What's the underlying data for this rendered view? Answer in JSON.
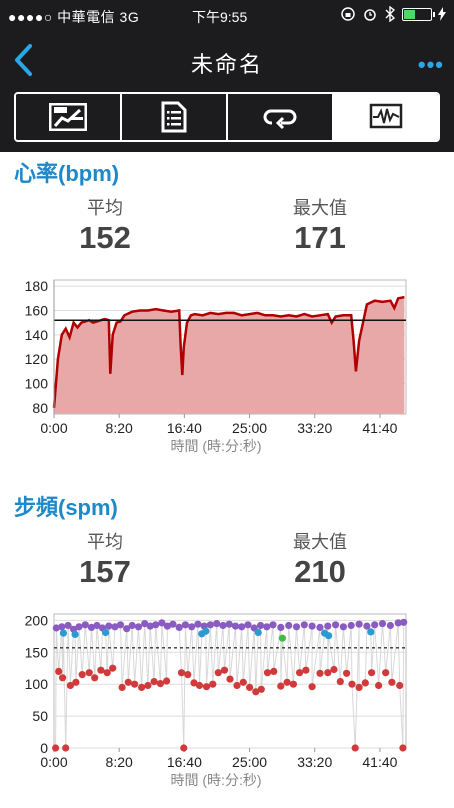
{
  "status_bar": {
    "carrier": "●●●●○ 中華電信 3G",
    "time": "下午9:55"
  },
  "nav": {
    "title": "未命名",
    "more_label": "•••"
  },
  "tabs": [
    {
      "icon": "summary-chart-icon",
      "active": false
    },
    {
      "icon": "document-list-icon",
      "active": false
    },
    {
      "icon": "laps-loop-icon",
      "active": false
    },
    {
      "icon": "graph-monitor-icon",
      "active": true
    }
  ],
  "heart_rate": {
    "title": "心率(bpm)",
    "avg_label": "平均",
    "avg_value": "152",
    "max_label": "最大值",
    "max_value": "171"
  },
  "cadence": {
    "title": "步頻(spm)",
    "avg_label": "平均",
    "avg_value": "157",
    "max_label": "最大值",
    "max_value": "210"
  },
  "colors": {
    "accent": "#1e88c8",
    "hr_line": "#b00000",
    "hr_fill": "#e8a8a8",
    "cad_purple": "#8a5cc2",
    "cad_blue": "#2a9ad0",
    "cad_green": "#45b84a",
    "cad_red": "#d03a3a"
  },
  "chart_data": [
    {
      "type": "area",
      "x_unit": "minutes",
      "xlabel": "時間 (時:分:秒)",
      "ylabel": "",
      "xlim": [
        0,
        45
      ],
      "ylim": [
        75,
        185
      ],
      "x_ticks": [
        "0:00",
        "8:20",
        "16:40",
        "25:00",
        "33:20",
        "41:40"
      ],
      "x_tick_values": [
        0,
        8.333,
        16.667,
        25,
        33.333,
        41.667
      ],
      "y_ticks": [
        80,
        100,
        120,
        140,
        160,
        180
      ],
      "average_line": 152,
      "x": [
        0,
        0.5,
        1,
        1.5,
        2,
        2.5,
        3,
        3.5,
        4,
        4.5,
        5,
        5.5,
        6,
        6.5,
        7,
        7.2,
        7.5,
        8,
        8.5,
        9,
        10,
        11,
        12,
        13,
        14,
        15,
        16,
        16.2,
        16.4,
        16.6,
        17,
        17.5,
        18,
        19,
        20,
        21,
        22,
        23,
        24,
        25,
        26,
        27,
        28,
        29,
        30,
        31,
        32,
        33,
        34,
        35,
        35.5,
        36,
        37,
        38,
        38.3,
        38.6,
        39,
        40,
        41,
        42,
        43,
        43.5,
        44,
        44.8
      ],
      "values": [
        80,
        120,
        140,
        145,
        138,
        150,
        146,
        150,
        151,
        152,
        150,
        151,
        152,
        153,
        152,
        108,
        140,
        150,
        151,
        156,
        159,
        160,
        160,
        161,
        160,
        159,
        160,
        130,
        107,
        130,
        150,
        156,
        157,
        156,
        158,
        157,
        158,
        158,
        156,
        157,
        158,
        156,
        156,
        155,
        156,
        155,
        157,
        155,
        156,
        157,
        150,
        155,
        156,
        156,
        135,
        110,
        135,
        165,
        168,
        167,
        168,
        162,
        170,
        171
      ]
    },
    {
      "type": "scatter",
      "x_unit": "minutes",
      "xlabel": "時間 (時:分:秒)",
      "ylabel": "",
      "xlim": [
        0,
        45
      ],
      "ylim": [
        0,
        210
      ],
      "x_ticks": [
        "0:00",
        "8:20",
        "16:40",
        "25:00",
        "33:20",
        "41:40"
      ],
      "x_tick_values": [
        0,
        8.333,
        16.667,
        25,
        33.333,
        41.667
      ],
      "y_ticks": [
        0,
        50,
        100,
        150,
        200
      ],
      "average_line": 157,
      "series": [
        {
          "color": "purple",
          "points": [
            [
              0.3,
              188
            ],
            [
              1,
              190
            ],
            [
              1.8,
              192
            ],
            [
              2.5,
              186
            ],
            [
              3.2,
              190
            ],
            [
              4,
              193
            ],
            [
              4.8,
              189
            ],
            [
              5.5,
              192
            ],
            [
              6.2,
              188
            ],
            [
              7,
              191
            ],
            [
              7.8,
              190
            ],
            [
              8.5,
              193
            ],
            [
              9.3,
              187
            ],
            [
              10,
              192
            ],
            [
              10.8,
              190
            ],
            [
              11.6,
              195
            ],
            [
              12.3,
              191
            ],
            [
              13,
              193
            ],
            [
              13.8,
              196
            ],
            [
              14.5,
              191
            ],
            [
              15.2,
              194
            ],
            [
              16,
              189
            ],
            [
              16.8,
              193
            ],
            [
              17.6,
              190
            ],
            [
              18.4,
              194
            ],
            [
              19.2,
              191
            ],
            [
              20,
              193
            ],
            [
              20.8,
              195
            ],
            [
              21.6,
              192
            ],
            [
              22.4,
              194
            ],
            [
              23.2,
              191
            ],
            [
              24,
              190
            ],
            [
              24.8,
              193
            ],
            [
              25.6,
              188
            ],
            [
              26.4,
              192
            ],
            [
              27.2,
              190
            ],
            [
              28,
              193
            ],
            [
              29,
              189
            ],
            [
              30,
              192
            ],
            [
              31,
              190
            ],
            [
              32,
              193
            ],
            [
              33,
              191
            ],
            [
              34,
              189
            ],
            [
              35,
              191
            ],
            [
              36,
              193
            ],
            [
              37,
              190
            ],
            [
              38,
              192
            ],
            [
              39,
              194
            ],
            [
              40,
              191
            ],
            [
              41,
              193
            ],
            [
              42,
              195
            ],
            [
              43,
              192
            ],
            [
              44,
              196
            ],
            [
              44.7,
              197
            ]
          ]
        },
        {
          "color": "blue",
          "points": [
            [
              1.2,
              180
            ],
            [
              2.7,
              178
            ],
            [
              6.6,
              181
            ],
            [
              18.9,
              179
            ],
            [
              19.4,
              183
            ],
            [
              26.1,
              181
            ],
            [
              34.6,
              180
            ],
            [
              35.1,
              176
            ],
            [
              40.5,
              182
            ]
          ]
        },
        {
          "color": "green",
          "points": [
            [
              29.2,
              172
            ]
          ]
        },
        {
          "color": "red",
          "points": [
            [
              0.6,
              120
            ],
            [
              1.1,
              110
            ],
            [
              2.1,
              98
            ],
            [
              2.8,
              103
            ],
            [
              3.6,
              115
            ],
            [
              4.5,
              118
            ],
            [
              5.2,
              110
            ],
            [
              6,
              122
            ],
            [
              6.8,
              118
            ],
            [
              7.5,
              125
            ],
            [
              8.7,
              95
            ],
            [
              9.5,
              103
            ],
            [
              10.3,
              100
            ],
            [
              11.2,
              95
            ],
            [
              12,
              98
            ],
            [
              12.8,
              104
            ],
            [
              13.6,
              101
            ],
            [
              14.4,
              105
            ],
            [
              16.3,
              118
            ],
            [
              17.1,
              115
            ],
            [
              17.9,
              102
            ],
            [
              18.6,
              98
            ],
            [
              19.5,
              96
            ],
            [
              20.3,
              100
            ],
            [
              21,
              118
            ],
            [
              21.8,
              122
            ],
            [
              22.5,
              108
            ],
            [
              23.4,
              98
            ],
            [
              24.2,
              103
            ],
            [
              25,
              95
            ],
            [
              25.8,
              88
            ],
            [
              26.5,
              92
            ],
            [
              27.3,
              118
            ],
            [
              28.1,
              120
            ],
            [
              29,
              97
            ],
            [
              29.8,
              103
            ],
            [
              30.6,
              100
            ],
            [
              31.4,
              118
            ],
            [
              32.2,
              122
            ],
            [
              33,
              96
            ],
            [
              34,
              117
            ],
            [
              35,
              118
            ],
            [
              35.8,
              123
            ],
            [
              36.6,
              104
            ],
            [
              37.4,
              117
            ],
            [
              38.1,
              100
            ],
            [
              39,
              95
            ],
            [
              39.8,
              102
            ],
            [
              40.6,
              118
            ],
            [
              41.5,
              98
            ],
            [
              42.4,
              118
            ],
            [
              43.2,
              103
            ],
            [
              44.2,
              98
            ],
            [
              0.2,
              0
            ],
            [
              1.5,
              0
            ],
            [
              16.6,
              0
            ],
            [
              38.5,
              0
            ],
            [
              44.6,
              0
            ]
          ]
        }
      ]
    }
  ]
}
